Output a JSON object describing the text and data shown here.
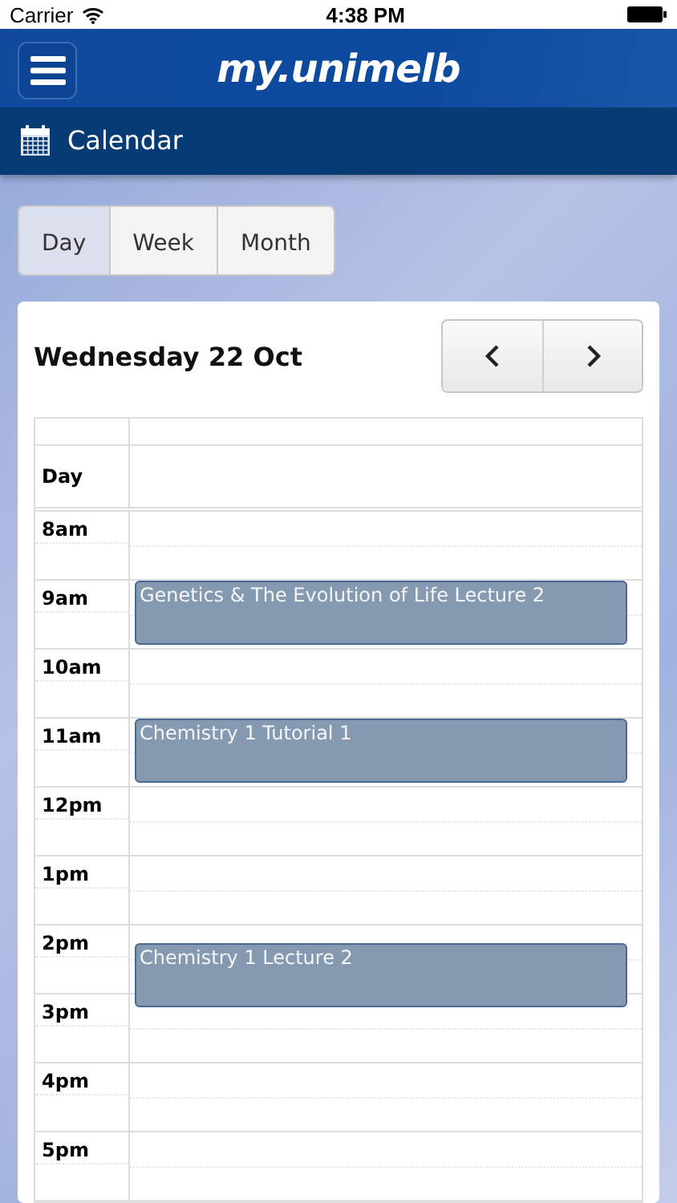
{
  "status_bar": {
    "carrier": "Carrier",
    "time": "4:38 PM"
  },
  "header": {
    "title": "my.unimelb"
  },
  "section": {
    "title": "Calendar"
  },
  "view_tabs": [
    {
      "label": "Day",
      "selected": true
    },
    {
      "label": "Week",
      "selected": false
    },
    {
      "label": "Month",
      "selected": false
    }
  ],
  "calendar": {
    "date": "Wednesday 22 Oct",
    "all_day_label": "Day",
    "hours": [
      {
        "label": "8am"
      },
      {
        "label": "9am",
        "events": [
          {
            "title": "Genetics & The Evolution of Life Lecture 2",
            "quarter_past": false
          }
        ]
      },
      {
        "label": "10am"
      },
      {
        "label": "11am",
        "events": [
          {
            "title": "Chemistry 1 Tutorial 1",
            "quarter_past": false
          }
        ]
      },
      {
        "label": "12pm"
      },
      {
        "label": "1pm"
      },
      {
        "label": "2pm",
        "events": [
          {
            "title": "Chemistry 1 Lecture 2",
            "quarter_past": true
          }
        ]
      },
      {
        "label": "3pm"
      },
      {
        "label": "4pm"
      },
      {
        "label": "5pm"
      }
    ]
  }
}
